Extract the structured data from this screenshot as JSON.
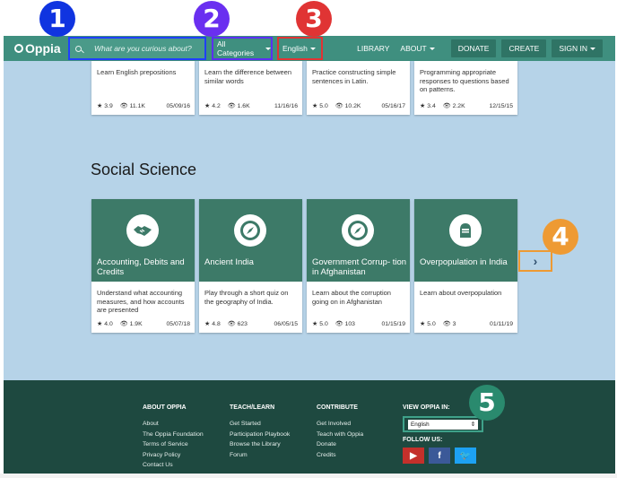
{
  "navbar": {
    "logo": "Oppia",
    "search_placeholder": "What are you curious about?",
    "categories_label": "All Categories",
    "language_label": "English",
    "library": "LIBRARY",
    "about": "ABOUT",
    "donate": "DONATE",
    "create": "CREATE",
    "sign_in": "SIGN IN"
  },
  "top_cards": [
    {
      "desc": "Learn English prepositions",
      "rating": "3.9",
      "views": "11.1K",
      "date": "05/09/16"
    },
    {
      "desc": "Learn the difference between similar words",
      "rating": "4.2",
      "views": "1.6K",
      "date": "11/16/16"
    },
    {
      "desc": "Practice constructing simple sentences in Latin.",
      "rating": "5.0",
      "views": "10.2K",
      "date": "05/16/17"
    },
    {
      "desc": "Programming appropriate responses to questions based on patterns.",
      "rating": "3.4",
      "views": "2.2K",
      "date": "12/15/15"
    }
  ],
  "section": {
    "title": "Social Science"
  },
  "cards": [
    {
      "title": "Accounting, Debits and Credits",
      "desc": "Understand what accounting measures, and how accounts are presented",
      "rating": "4.0",
      "views": "1.9K",
      "date": "05/07/18",
      "icon": "handshake-icon"
    },
    {
      "title": "Ancient India",
      "desc": "Play through a short quiz on the geography of India.",
      "rating": "4.8",
      "views": "623",
      "date": "06/05/15",
      "icon": "compass-icon"
    },
    {
      "title": "Government Corrup- tion in Afghanistan",
      "desc": "Learn about the corruption going on in Afghanistan",
      "rating": "5.0",
      "views": "103",
      "date": "01/15/19",
      "icon": "compass-icon"
    },
    {
      "title": "Overpopulation in India",
      "desc": "Learn about overpopulation",
      "rating": "5.0",
      "views": "3",
      "date": "01/11/19",
      "icon": "helmet-icon"
    }
  ],
  "next_label": "›",
  "footer": {
    "about_heading": "ABOUT OPPIA",
    "about_links": [
      "About",
      "The Oppia Foundation",
      "Terms of Service",
      "Privacy Policy",
      "Contact Us"
    ],
    "teach_heading": "TEACH/LEARN",
    "teach_links": [
      "Get Started",
      "Participation Playbook",
      "Browse the Library",
      "Forum"
    ],
    "contribute_heading": "CONTRIBUTE",
    "contribute_links": [
      "Get Involved",
      "Teach with Oppia",
      "Donate",
      "Credits"
    ],
    "view_heading": "VIEW OPPIA IN:",
    "view_language": "English",
    "follow_heading": "FOLLOW US:"
  },
  "badges": [
    "1",
    "2",
    "3",
    "4",
    "5"
  ],
  "colors": {
    "badge1": "#1034e0",
    "badge2": "#6a2ff0",
    "badge3": "#e03434",
    "badge4": "#ee9a33",
    "badge5": "#2a8a6e",
    "navbar": "#3f8f7f",
    "main_bg": "#b6d3e8",
    "footer_bg": "#1e4940"
  }
}
